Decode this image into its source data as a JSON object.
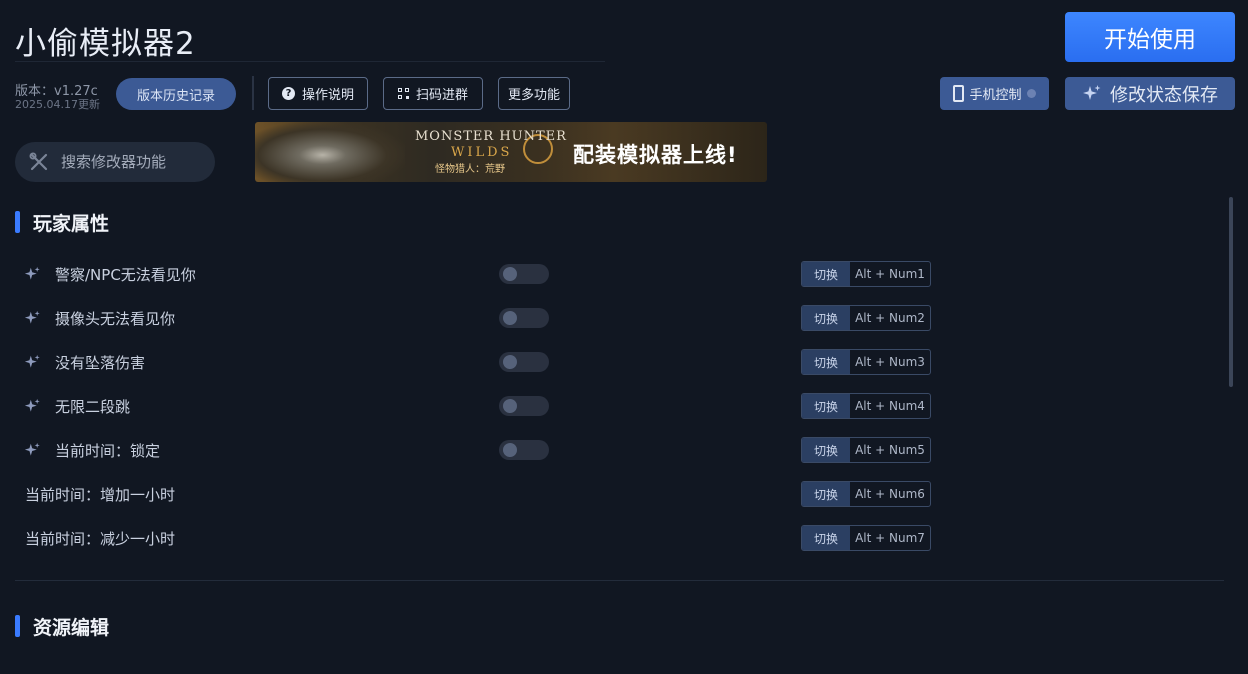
{
  "app": {
    "title": "小偷模拟器2",
    "start_label": "开始使用",
    "version_label": "版本：v1.27c",
    "version_date": "2025.04.17更新"
  },
  "toolbar": {
    "history_label": "版本历史记录",
    "help_label": "操作说明",
    "scan_label": "扫码进群",
    "more_label": "更多功能",
    "phone_label": "手机控制",
    "save_label": "修改状态保存"
  },
  "search": {
    "placeholder": "搜索修改器功能"
  },
  "banner": {
    "game_title": "MONSTER HUNTER",
    "game_subtitle": "WILDS",
    "game_cn": "怪物猎人：荒野",
    "cta": "配装模拟器上线!"
  },
  "sections": {
    "player": {
      "title": "玩家属性"
    },
    "resources": {
      "title": "资源编辑"
    }
  },
  "cheats": [
    {
      "label": "警察/NPC无法看见你",
      "has_toggle": true,
      "toggle_on": false,
      "action": "切换",
      "keys": "Alt + Num1"
    },
    {
      "label": "摄像头无法看见你",
      "has_toggle": true,
      "toggle_on": false,
      "action": "切换",
      "keys": "Alt + Num2"
    },
    {
      "label": "没有坠落伤害",
      "has_toggle": true,
      "toggle_on": false,
      "action": "切换",
      "keys": "Alt + Num3"
    },
    {
      "label": "无限二段跳",
      "has_toggle": true,
      "toggle_on": false,
      "action": "切换",
      "keys": "Alt + Num4"
    },
    {
      "label": "当前时间：锁定",
      "has_toggle": true,
      "toggle_on": false,
      "action": "切换",
      "keys": "Alt + Num5"
    },
    {
      "label": "当前时间：增加一小时",
      "has_toggle": false,
      "action": "切换",
      "keys": "Alt + Num6"
    },
    {
      "label": "当前时间：减少一小时",
      "has_toggle": false,
      "action": "切换",
      "keys": "Alt + Num7"
    }
  ],
  "colors": {
    "background": "#111722",
    "accent": "#3a7bff",
    "button": "#3c5a95"
  },
  "icons": {
    "spark": "sparkle-icon",
    "search": "wrench-search-icon",
    "phone": "phone-icon",
    "help": "help-circle-icon",
    "qr": "qr-code-icon"
  }
}
